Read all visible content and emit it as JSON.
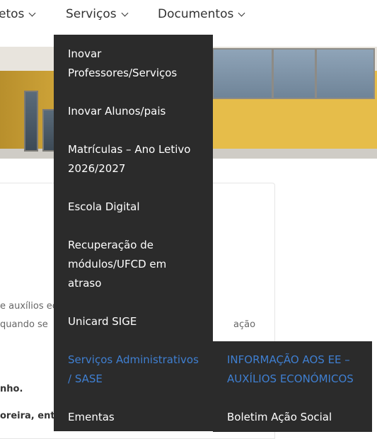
{
  "nav": {
    "items": [
      {
        "label": "etos"
      },
      {
        "label": "Serviços"
      },
      {
        "label": "Documentos"
      }
    ]
  },
  "background_text": {
    "line1": "e auxílios ec",
    "line2": "quando se",
    "line2_right": "ação",
    "line3": "nho.",
    "line4": "oreira, entre"
  },
  "dropdown": {
    "items": [
      {
        "label": "Inovar Professores/Serviços"
      },
      {
        "label": "Inovar Alunos/pais"
      },
      {
        "label": "Matrículas – Ano Letivo 2026/2027"
      },
      {
        "label": "Escola Digital"
      },
      {
        "label": "Recuperação de módulos/UFCD em atraso"
      },
      {
        "label": "Unicard SIGE"
      },
      {
        "label": "Serviços Administrativos / SASE"
      },
      {
        "label": "Ementas"
      }
    ]
  },
  "submenu": {
    "items": [
      {
        "label": "INFORMAÇÃO AOS EE – AUXÍLIOS ECONÓMICOS"
      },
      {
        "label": "Boletim Ação Social"
      }
    ]
  },
  "colors": {
    "menu_bg": "#2b2b2b",
    "menu_text": "#ffffff",
    "accent": "#3f7fd1"
  }
}
